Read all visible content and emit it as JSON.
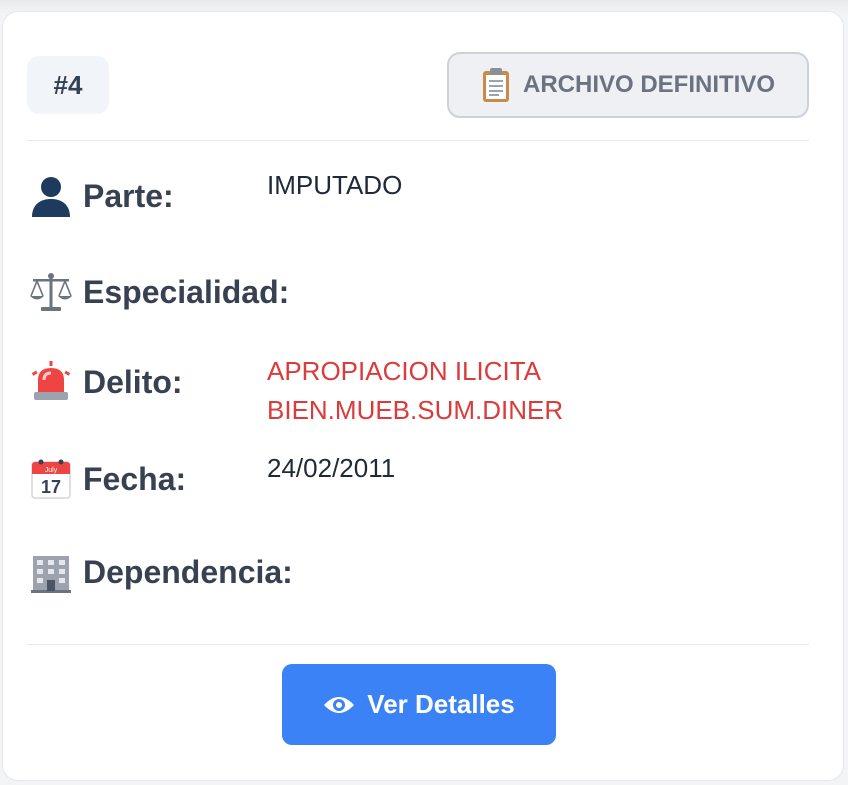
{
  "card": {
    "case_number": "#4",
    "status": {
      "icon": "clipboard-icon",
      "label": "ARCHIVO DEFINITIVO"
    },
    "fields": {
      "parte": {
        "icon": "person-icon",
        "label": "Parte:",
        "value": "IMPUTADO"
      },
      "especialidad": {
        "icon": "scales-icon",
        "label": "Especialidad:",
        "value": ""
      },
      "delito": {
        "icon": "siren-icon",
        "label": "Delito:",
        "value_line1": "APROPIACION ILICITA",
        "value_line2": "BIEN.MUEB.SUM.DINER",
        "color": "#dc3b3b"
      },
      "fecha": {
        "icon": "calendar-icon",
        "label": "Fecha:",
        "value": "24/02/2011",
        "calendar_month": "July",
        "calendar_day": "17"
      },
      "dependencia": {
        "icon": "building-icon",
        "label": "Dependencia:",
        "value": ""
      }
    },
    "action_button": {
      "icon": "eye-icon",
      "label": "Ver Detalles",
      "color": "#3b82f6"
    }
  }
}
